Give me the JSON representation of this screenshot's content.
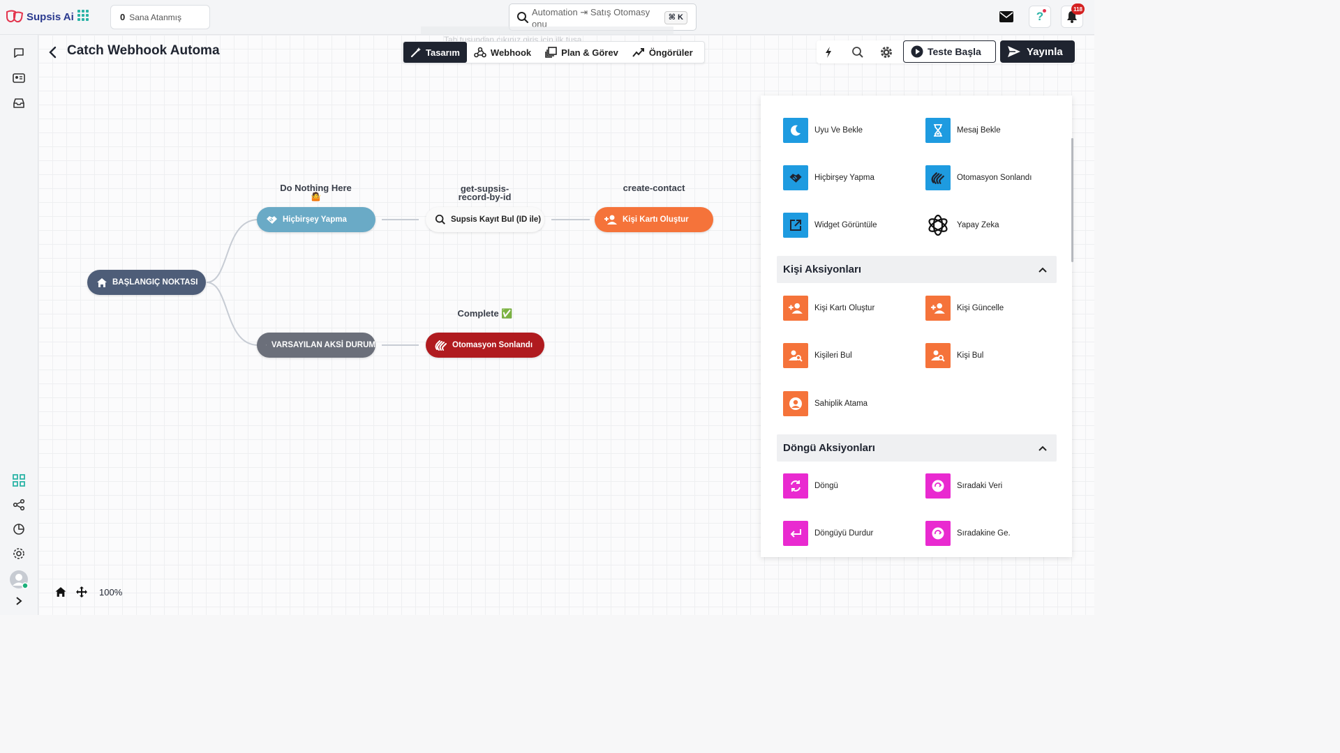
{
  "header": {
    "logo_text": "Supsis Ai",
    "assigned_count": "0",
    "assigned_label": "Sana Atanmış",
    "search_value": "Automation ⇥ Satış Otomasy onu",
    "search_shortcut": "⌘ K",
    "notification_count": "118"
  },
  "page": {
    "title": "Catch Webhook Automa"
  },
  "tabs": [
    {
      "label": "Tasarım",
      "active": true
    },
    {
      "label": "Webhook"
    },
    {
      "label": "Plan & Görev"
    },
    {
      "label": "Öngörüler"
    }
  ],
  "toolbar": {
    "test_label": "Teste Başla",
    "publish_label": "Yayınla"
  },
  "flow": {
    "start": "BAŞLANGIÇ NOKTASI",
    "nodes": {
      "nothing": {
        "label": "Do Nothing Here",
        "emoji": "🤷",
        "text": "Hiçbirşey Yapma"
      },
      "find": {
        "label": "get-supsis-record-by-id",
        "text": "Supsis Kayıt Bul (ID ile)"
      },
      "contact": {
        "label": "create-contact",
        "text": "Kişi Kartı Oluştur"
      },
      "default": {
        "text": "VARSAYILAN AKSİ DURUM"
      },
      "end": {
        "label": "Complete ✅",
        "text": "Otomasyon Sonlandı"
      }
    }
  },
  "panel": {
    "general": [
      {
        "label": "Uyu Ve Bekle",
        "icon": "moon-icon",
        "color": "#1e9be0"
      },
      {
        "label": "Mesaj Bekle",
        "icon": "hourglass-icon",
        "color": "#1e9be0"
      },
      {
        "label": "Hiçbirşey Yapma",
        "icon": "handshake-icon",
        "color": "#1e9be0"
      },
      {
        "label": "Otomasyon Sonlandı",
        "icon": "wave-hand-icon",
        "color": "#1e9be0"
      },
      {
        "label": "Widget Görüntüle",
        "icon": "external-link-icon",
        "color": "#1e9be0"
      },
      {
        "label": "Yapay Zeka",
        "icon": "openai-icon",
        "color": "#ffffff"
      }
    ],
    "contact_section": "Kişi Aksiyonları",
    "contact": [
      {
        "label": "Kişi Kartı Oluştur",
        "icon": "user-plus-icon",
        "color": "#f5733a"
      },
      {
        "label": "Kişi Güncelle",
        "icon": "user-edit-icon",
        "color": "#f5733a"
      },
      {
        "label": "Kişileri Bul",
        "icon": "user-search-icon",
        "color": "#f5733a"
      },
      {
        "label": "Kişi Bul",
        "icon": "user-search-icon",
        "color": "#f5733a"
      },
      {
        "label": "Sahiplik Atama",
        "icon": "user-circle-icon",
        "color": "#f5733a"
      }
    ],
    "loop_section": "Döngü Aksiyonları",
    "loop": [
      {
        "label": "Döngü",
        "icon": "loop-icon",
        "color": "#e92ad0"
      },
      {
        "label": "Sıradaki Veri",
        "icon": "next-icon",
        "color": "#e92ad0"
      },
      {
        "label": "Döngüyü Durdur",
        "icon": "return-icon",
        "color": "#e92ad0"
      },
      {
        "label": "Sıradakine Ge.",
        "icon": "next-icon",
        "color": "#e92ad0"
      }
    ]
  },
  "zoom": {
    "level": "100%"
  }
}
